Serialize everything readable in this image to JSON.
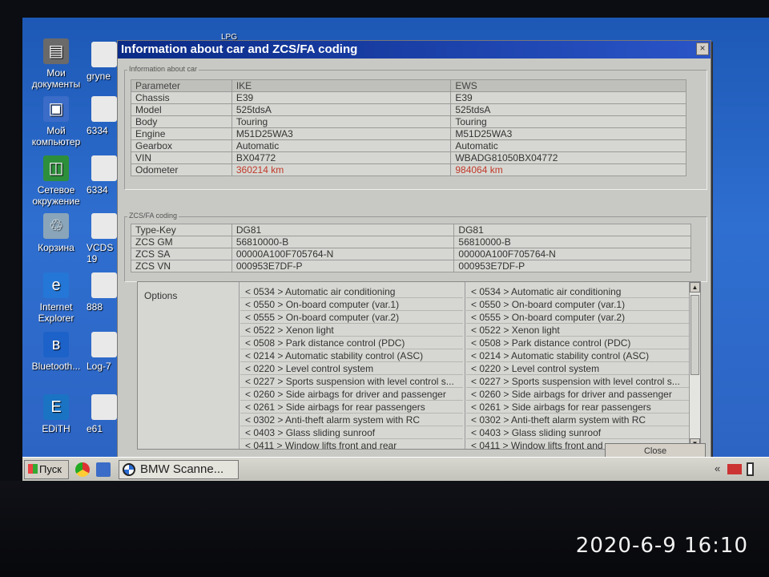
{
  "desktop": {
    "icons": [
      {
        "name": "my-documents-icon",
        "label": "Мои документы",
        "glyph": "▤",
        "color": "#6a6a6a"
      },
      {
        "name": "my-computer-icon",
        "label": "Мой компьютер",
        "glyph": "▣",
        "color": "#3b6cc7"
      },
      {
        "name": "network-icon",
        "label": "Сетевое окружение",
        "glyph": "◫",
        "color": "#2d8f3b"
      },
      {
        "name": "recycle-bin-icon",
        "label": "Корзина",
        "glyph": "♲",
        "color": "#8aa5b9"
      },
      {
        "name": "internet-explorer-icon",
        "label": "Internet Explorer",
        "glyph": "e",
        "color": "#2477d6"
      },
      {
        "name": "bluetooth-icon",
        "label": "Bluetooth...",
        "glyph": "ʙ",
        "color": "#1d62c8"
      },
      {
        "name": "edith-icon",
        "label": "EDiTH",
        "glyph": "E",
        "color": "#1b73c4"
      }
    ],
    "partial_icons": [
      {
        "name": "gryn-icon",
        "label": "gryne"
      },
      {
        "name": "file-6334-icon",
        "label": "6334"
      },
      {
        "name": "file-6334b-icon",
        "label": "6334"
      },
      {
        "name": "vcds-icon",
        "label": "VCDS 19"
      },
      {
        "name": "file-888-icon",
        "label": "888"
      },
      {
        "name": "log-icon",
        "label": "Log-7"
      },
      {
        "name": "e61-icon",
        "label": "e61"
      }
    ],
    "top_labels": [
      "LPG"
    ]
  },
  "dialog": {
    "title": "Information about car and ZCS/FA coding",
    "close_glyph": "×",
    "info_group_label": "Information about car",
    "zcs_group_label": "ZCS/FA coding",
    "close_button_label": "Close"
  },
  "car_info": {
    "headers": [
      "Parameter",
      "IKE",
      "EWS"
    ],
    "rows": [
      {
        "param": "Chassis",
        "ike": "E39",
        "ews": "E39"
      },
      {
        "param": "Model",
        "ike": "525tdsA",
        "ews": "525tdsA"
      },
      {
        "param": "Body",
        "ike": "Touring",
        "ews": "Touring"
      },
      {
        "param": "Engine",
        "ike": "M51D25WA3",
        "ews": "M51D25WA3"
      },
      {
        "param": "Gearbox",
        "ike": "Automatic",
        "ews": "Automatic"
      },
      {
        "param": "VIN",
        "ike": "BX04772",
        "ews": "WBADG81050BX04772"
      },
      {
        "param": "Odometer",
        "ike": "360214 km",
        "ews": "984064 km"
      }
    ]
  },
  "zcs": {
    "rows": [
      {
        "param": "Type-Key",
        "ike": "DG81",
        "ews": "DG81"
      },
      {
        "param": "ZCS GM",
        "ike": "56810000-B",
        "ews": "56810000-B"
      },
      {
        "param": "ZCS SA",
        "ike": "00000A100F705764-N",
        "ews": "00000A100F705764-N"
      },
      {
        "param": "ZCS VN",
        "ike": "000953E7DF-P",
        "ews": "000953E7DF-P"
      }
    ]
  },
  "options": {
    "label": "Options",
    "ike": [
      "< 0534 > Automatic air conditioning",
      "< 0550 > On-board computer (var.1)",
      "< 0555 > On-board computer (var.2)",
      "< 0522 > Xenon light",
      "< 0508 > Park distance control (PDC)",
      "< 0214 > Automatic stability control (ASC)",
      "< 0220 > Level control system",
      "< 0227 > Sports suspension with level control s...",
      "< 0260 > Side airbags for driver and passenger",
      "< 0261 > Side airbags for rear passengers",
      "< 0302 > Anti-theft alarm system with RC",
      "< 0403 > Glass sliding sunroof",
      "< 0411 > Window lifts front and rear"
    ],
    "ews": [
      "< 0534 > Automatic air conditioning",
      "< 0550 > On-board computer (var.1)",
      "< 0555 > On-board computer (var.2)",
      "< 0522 > Xenon light",
      "< 0508 > Park distance control (PDC)",
      "< 0214 > Automatic stability control (ASC)",
      "< 0220 > Level control system",
      "< 0227 > Sports suspension with level control s...",
      "< 0260 > Side airbags for driver and passenger",
      "< 0261 > Side airbags for rear passengers",
      "< 0302 > Anti-theft alarm system with RC",
      "< 0403 > Glass sliding sunroof",
      "< 0411 > Window lifts front and rear"
    ]
  },
  "taskbar": {
    "start_label": "Пуск",
    "task_label": "BMW Scanne...",
    "tray_label": "«"
  },
  "photo_timestamp": "2020-6-9 16:10"
}
